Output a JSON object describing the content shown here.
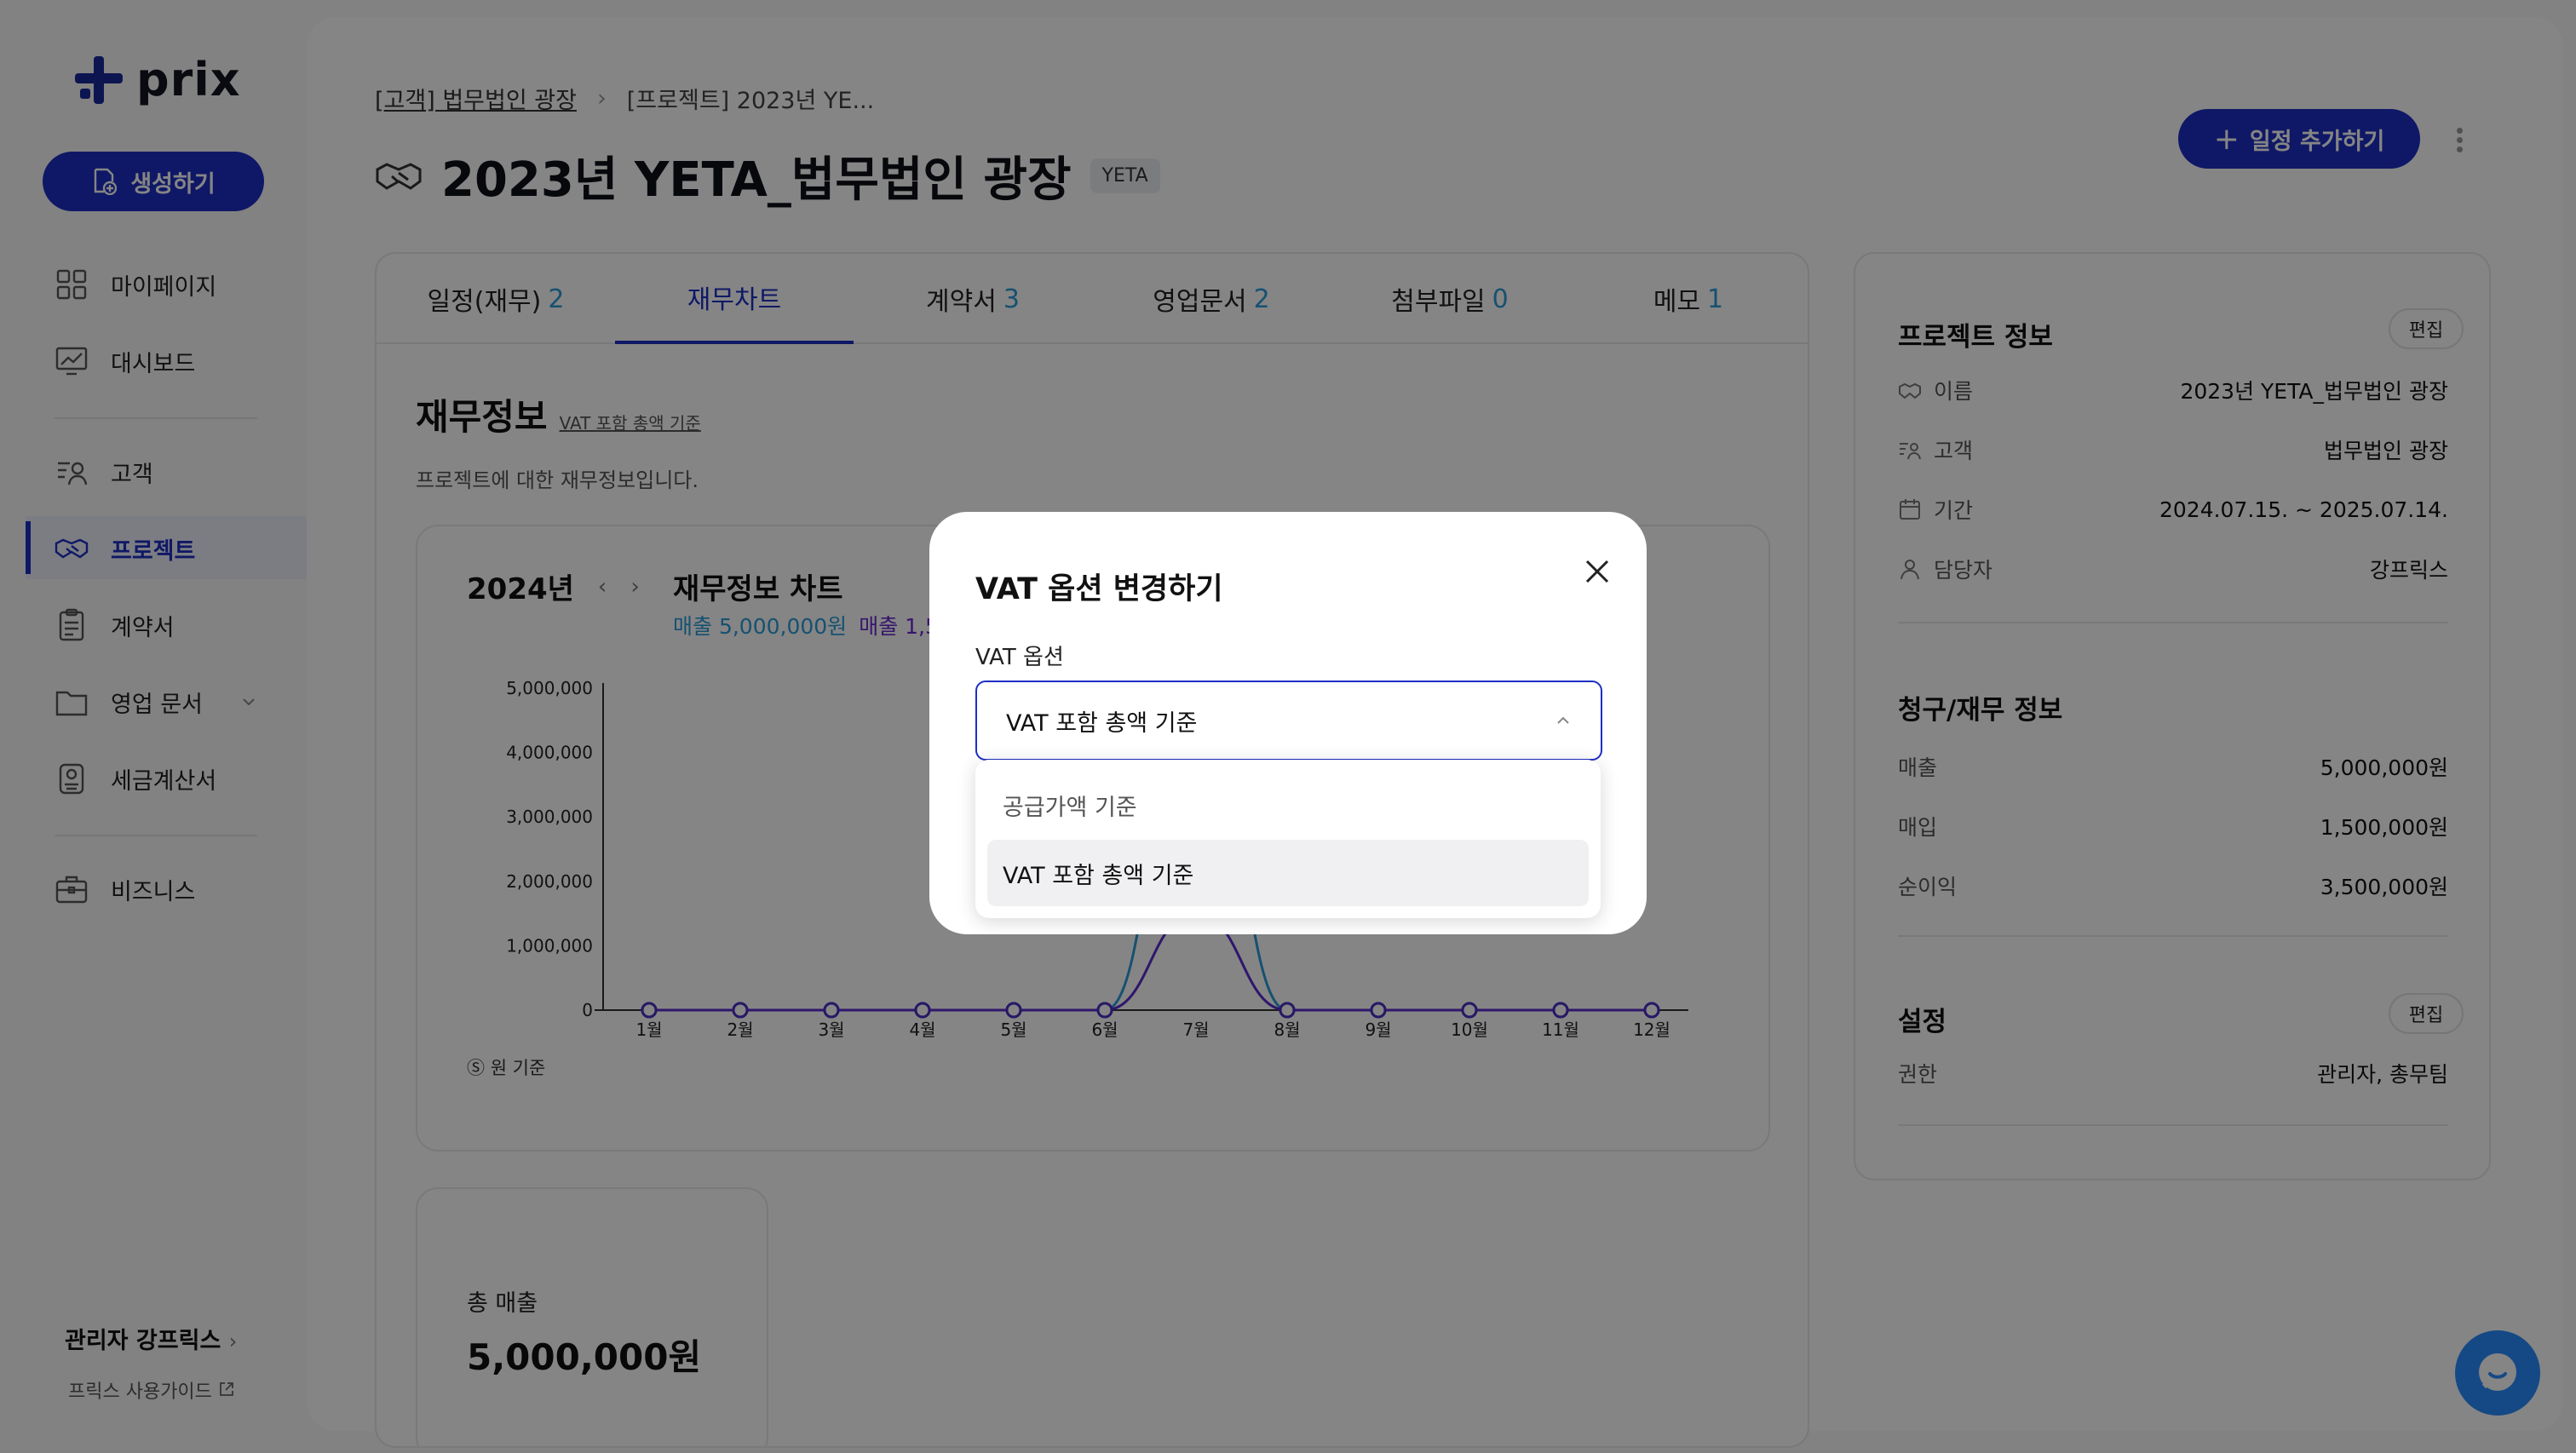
{
  "app": {
    "name": "prix"
  },
  "sidebar": {
    "create_label": "생성하기",
    "items": [
      {
        "label": "마이페이지",
        "icon": "grid-icon"
      },
      {
        "label": "대시보드",
        "icon": "dashboard-icon"
      },
      {
        "label": "고객",
        "icon": "customers-icon"
      },
      {
        "label": "프로젝트",
        "icon": "handshake-icon"
      },
      {
        "label": "계약서",
        "icon": "contract-icon"
      },
      {
        "label": "영업 문서",
        "icon": "folder-icon"
      },
      {
        "label": "세금계산서",
        "icon": "invoice-icon"
      },
      {
        "label": "비즈니스",
        "icon": "briefcase-icon"
      }
    ],
    "user": "관리자 강프릭스",
    "guide": "프릭스 사용가이드"
  },
  "header": {
    "breadcrumb": [
      "[고객] 법무법인 광장",
      "[프로젝트] 2023년 YE..."
    ],
    "title": "2023년 YETA_법무법인 광장",
    "tag": "YETA",
    "add_label": "일정 추가하기"
  },
  "tabs": [
    {
      "label": "일정(재무)",
      "count": "2"
    },
    {
      "label": "재무차트",
      "count": ""
    },
    {
      "label": "계약서",
      "count": "3"
    },
    {
      "label": "영업문서",
      "count": "2"
    },
    {
      "label": "첨부파일",
      "count": "0"
    },
    {
      "label": "메모",
      "count": "1"
    }
  ],
  "finance": {
    "title": "재무정보",
    "vat_basis": "VAT 포함 총액 기준",
    "description": "프로젝트에 대한 재무정보입니다.",
    "chart": {
      "year": "2024년",
      "name": "재무정보 차트",
      "legend_sales": "매출 5,000,000원",
      "legend_purchase": "매출 1,5",
      "unit": "원 기준"
    },
    "total_sales_label": "총 매출",
    "total_sales_value": "5,000,000원"
  },
  "chart_data": {
    "type": "line",
    "categories": [
      "1월",
      "2월",
      "3월",
      "4월",
      "5월",
      "6월",
      "7월",
      "8월",
      "9월",
      "10월",
      "11월",
      "12월"
    ],
    "y_ticks": [
      "5,000,000",
      "4,000,000",
      "3,000,000",
      "2,000,000",
      "1,000,000",
      "0"
    ],
    "ylim": [
      0,
      5000000
    ],
    "series": [
      {
        "name": "매출",
        "values": [
          0,
          0,
          0,
          0,
          0,
          0,
          5000000,
          0,
          0,
          0,
          0,
          0
        ],
        "color": "#2b9cd8"
      },
      {
        "name": "매입",
        "values": [
          0,
          0,
          0,
          0,
          0,
          0,
          1500000,
          0,
          0,
          0,
          0,
          0
        ],
        "color": "#5a2bd0"
      }
    ],
    "grid": false
  },
  "info": {
    "project_title": "프로젝트 정보",
    "edit": "편집",
    "rows": [
      {
        "k": "이름",
        "v": "2023년 YETA_법무법인 광장"
      },
      {
        "k": "고객",
        "v": "법무법인 광장"
      },
      {
        "k": "기간",
        "v": "2024.07.15. ~ 2025.07.14."
      },
      {
        "k": "담당자",
        "v": "강프릭스"
      }
    ],
    "billing_title": "청구/재무 정보",
    "billing": [
      {
        "k": "매출",
        "v": "5,000,000원"
      },
      {
        "k": "매입",
        "v": "1,500,000원"
      },
      {
        "k": "순이익",
        "v": "3,500,000원"
      }
    ],
    "settings_title": "설정",
    "settings": [
      {
        "k": "권한",
        "v": "관리자, 총무팀"
      }
    ]
  },
  "modal": {
    "title": "VAT 옵션 변경하기",
    "label": "VAT 옵션",
    "selected": "VAT 포함 총액 기준",
    "options": [
      "공급가액 기준",
      "VAT 포함 총액 기준"
    ]
  },
  "colors": {
    "primary": "#1e2fc4",
    "accent": "#2b9cd8",
    "purple": "#5a2bd0",
    "chat": "#2a8cff"
  }
}
